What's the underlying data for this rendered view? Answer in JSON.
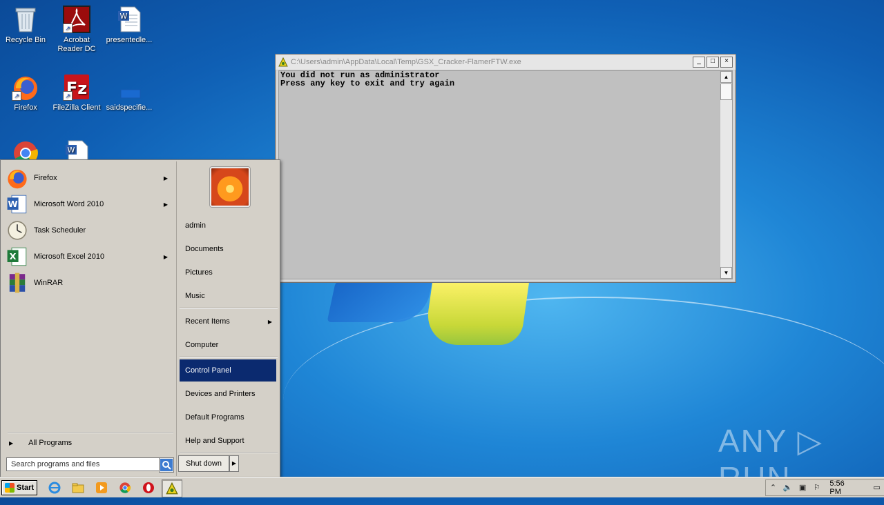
{
  "desktop": {
    "icons": [
      {
        "label": "Recycle Bin"
      },
      {
        "label": "Acrobat\nReader DC"
      },
      {
        "label": "presentedle..."
      },
      {
        "label": "Firefox"
      },
      {
        "label": "FileZilla Client"
      },
      {
        "label": "saidspecifie..."
      }
    ]
  },
  "console": {
    "title": "C:\\Users\\admin\\AppData\\Local\\Temp\\GSX_Cracker-FlamerFTW.exe",
    "lines": "You did not run as administrator\nPress any key to exit and try again",
    "minimize": "_",
    "maximize": "□",
    "close": "×"
  },
  "start_menu": {
    "programs": [
      {
        "label": "Firefox",
        "has_submenu": true
      },
      {
        "label": "Microsoft Word 2010",
        "has_submenu": true
      },
      {
        "label": "Task Scheduler",
        "has_submenu": false
      },
      {
        "label": "Microsoft Excel 2010",
        "has_submenu": true
      },
      {
        "label": "WinRAR",
        "has_submenu": false
      }
    ],
    "all_programs": "All Programs",
    "search_placeholder": "Search programs and files",
    "right_items": {
      "admin": "admin",
      "documents": "Documents",
      "pictures": "Pictures",
      "music": "Music",
      "recent_items": "Recent Items",
      "computer": "Computer",
      "control_panel": "Control Panel",
      "devices_printers": "Devices and Printers",
      "default_programs": "Default Programs",
      "help_support": "Help and Support"
    },
    "shutdown": "Shut down"
  },
  "taskbar": {
    "start_label": "Start",
    "clock": "5:56 PM"
  },
  "watermark": "ANY ▷ RUN",
  "colors": {
    "highlight": "#0b2a6f",
    "desktop": "#1f86d6"
  }
}
